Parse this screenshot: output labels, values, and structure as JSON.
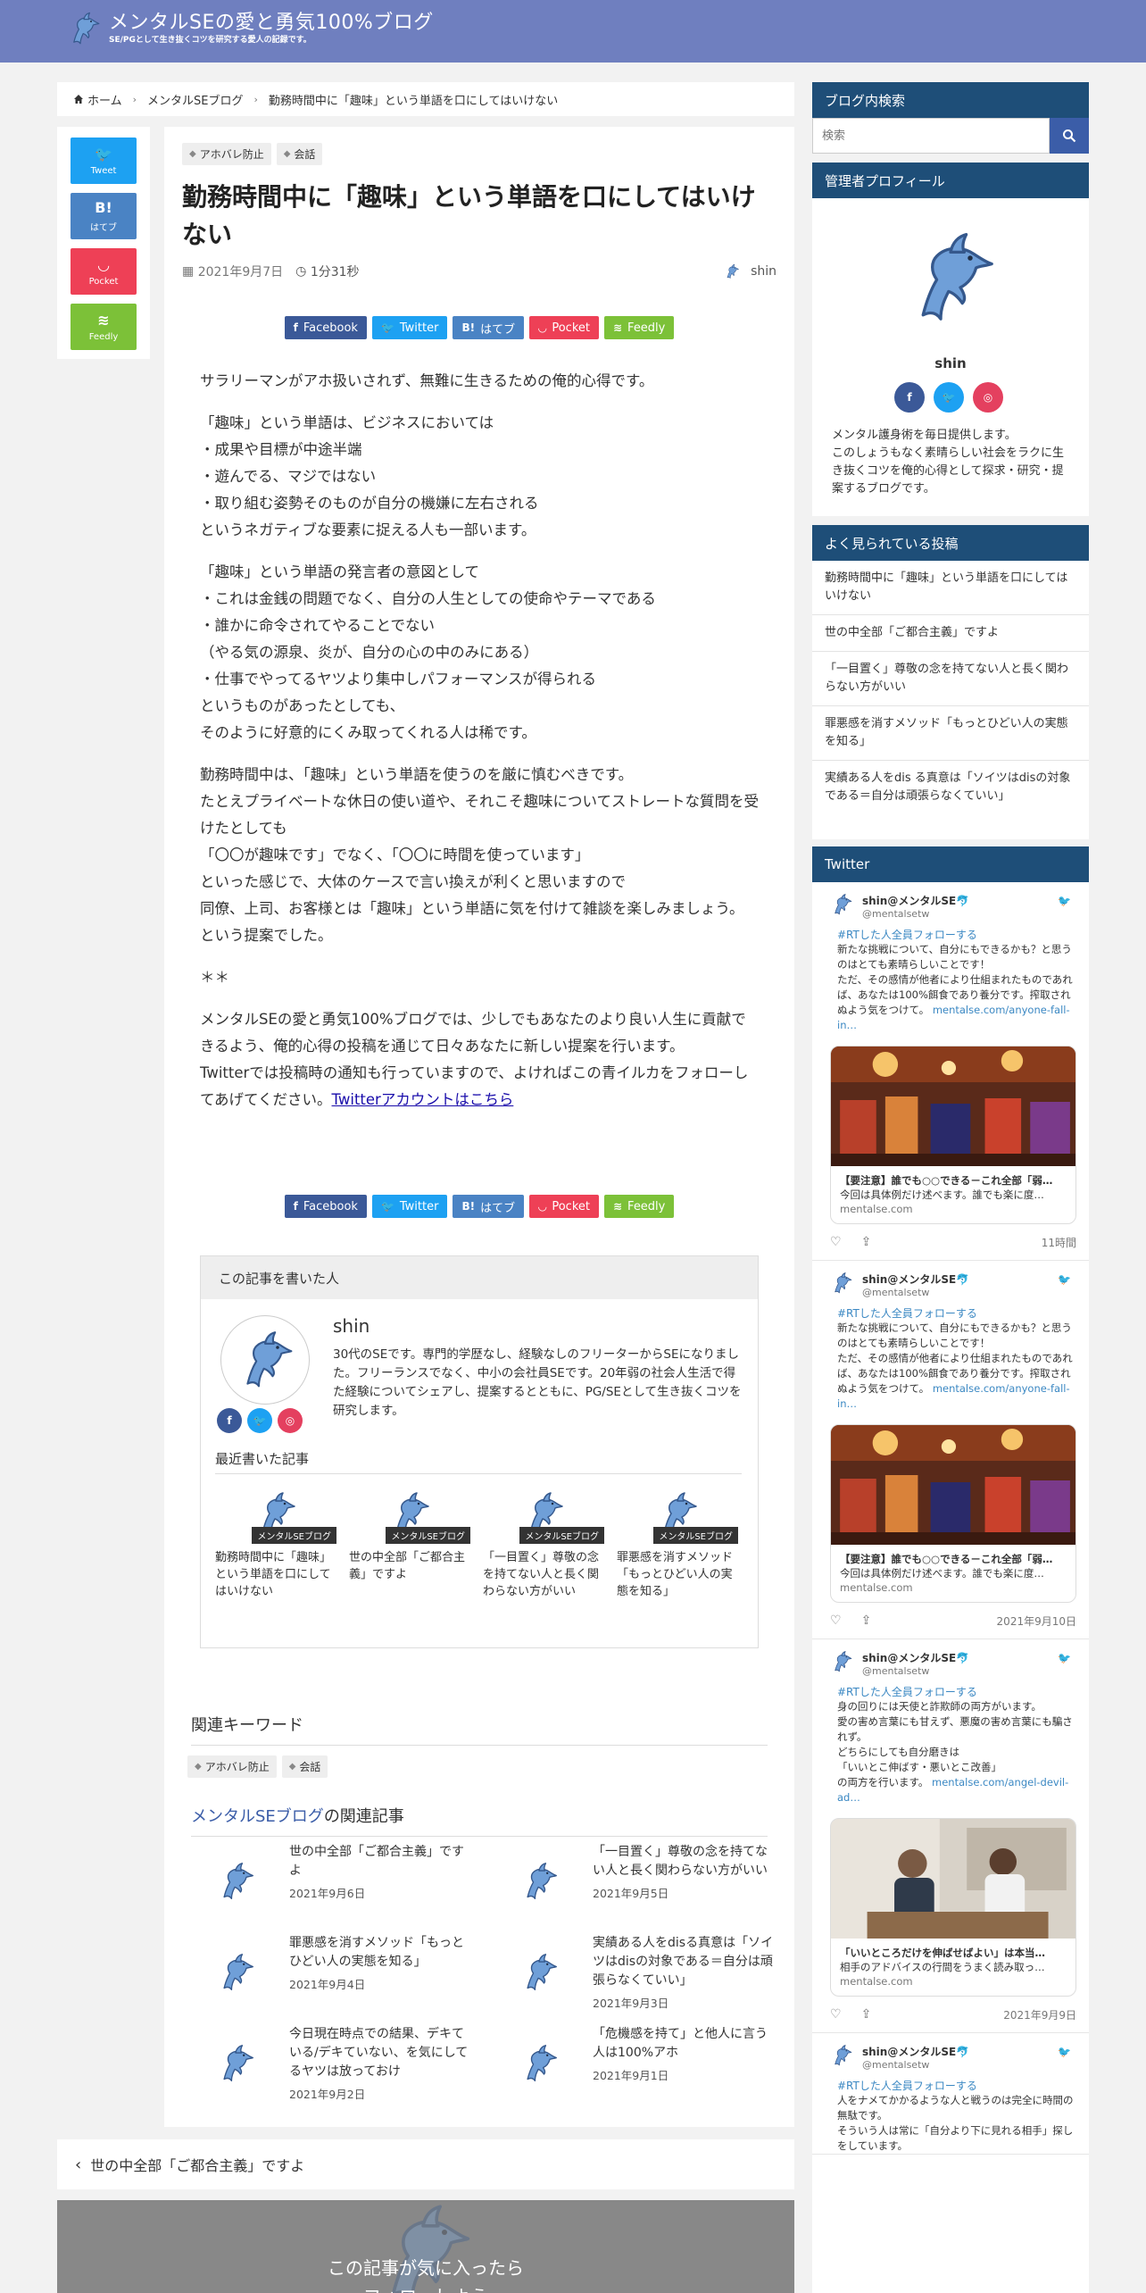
{
  "header": {
    "title": "メンタルSEの愛と勇気100%ブログ",
    "subtitle": "SE/PGとして生き抜くコツを研究する愛人の記録です。"
  },
  "breadcrumb": [
    "ホーム",
    "メンタルSEブログ",
    "勤務時間中に「趣味」という単語を口にしてはいけない"
  ],
  "side_share": [
    {
      "label": "Tweet",
      "icon": "twitter-bird-icon",
      "glyph": "🐦",
      "color": "#1da1f2"
    },
    {
      "label": "はてブ",
      "icon": "hatena-icon",
      "glyph": "B!",
      "color": "#4a83c4"
    },
    {
      "label": "Pocket",
      "icon": "pocket-icon",
      "glyph": "◡",
      "color": "#ee4056"
    },
    {
      "label": "Feedly",
      "icon": "feedly-icon",
      "glyph": "≋",
      "color": "#7cc138"
    }
  ],
  "article": {
    "tags": [
      "アホバレ防止",
      "会話"
    ],
    "title": "勤務時間中に「趣味」という単語を口にしてはいけない",
    "date": "2021年9月7日",
    "read_time": "1分31秒",
    "author": "shin",
    "paragraphs": [
      "サラリーマンがアホ扱いされず、無難に生きるための俺的心得です。",
      "「趣味」という単語は、ビジネスにおいては\n・成果や目標が中途半端\n・遊んでる、マジではない\n・取り組む姿勢そのものが自分の機嫌に左右される\nというネガティブな要素に捉える人も一部います。",
      "「趣味」という単語の発言者の意図として\n・これは金銭の問題でなく、自分の人生としての使命やテーマである\n・誰かに命令されてやることでない\n（やる気の源泉、炎が、自分の心の中のみにある）\n・仕事でやってるヤツより集中しパフォーマンスが得られる\nというものがあったとしても、\nそのように好意的にくみ取ってくれる人は稀です。",
      "勤務時間中は、「趣味」という単語を使うのを厳に慎むべきです。\nたとえプライベートな休日の使い道や、それこそ趣味についてストレートな質問を受けたとしても\n「〇〇が趣味です」でなく、「〇〇に時間を使っています」\nといった感じで、大体のケースで言い換えが利くと思いますので\n同僚、上司、お客様とは「趣味」という単語に気を付けて雑談を楽しみましょう。\nという提案でした。",
      "＊＊"
    ],
    "closing": "メンタルSEの愛と勇気100%ブログでは、少しでもあなたのより良い人生に貢献できるよう、俺的心得の投稿を通じて日々あなたに新しい提案を行います。\nTwitterでは投稿時の通知も行っていますので、よければこの青イルカをフォローしてあげてください。",
    "twitter_link": "Twitterアカウントはこちら",
    "share_buttons": [
      {
        "label": "Facebook",
        "glyph": "f",
        "color": "#3b5998"
      },
      {
        "label": "Twitter",
        "glyph": "🐦",
        "color": "#1da1f2"
      },
      {
        "label": "はてブ",
        "glyph": "B!",
        "color": "#4a83c4"
      },
      {
        "label": "Pocket",
        "glyph": "◡",
        "color": "#ee4056"
      },
      {
        "label": "Feedly",
        "glyph": "≋",
        "color": "#7cc138"
      }
    ]
  },
  "author_box": {
    "heading": "この記事を書いた人",
    "name": "shin",
    "description": "30代のSEです。専門的学歴なし、経験なしのフリーターからSEになりました。フリーランスでなく、中小の会社員SEです。20年弱の社会人生活で得た経験についてシェアし、提案するとともに、PG/SEとして生き抜くコツを研究します。",
    "recent_heading": "最近書いた記事",
    "recent_category": "メンタルSEブログ",
    "recent": [
      "勤務時間中に「趣味」という単語を口にしてはいけない",
      "世の中全部「ご都合主義」ですよ",
      "「一目置く」尊敬の念を持てない人と長く関わらない方がいい",
      "罪悪感を消すメソッド「もっとひどい人の実態を知る」"
    ]
  },
  "keywords": {
    "heading": "関連キーワード",
    "tags": [
      "アホバレ防止",
      "会話"
    ]
  },
  "related": {
    "heading_accent": "メンタルSEブログ",
    "heading_rest": "の関連記事",
    "items": [
      {
        "title": "世の中全部「ご都合主義」ですよ",
        "date": "2021年9月6日"
      },
      {
        "title": "「一目置く」尊敬の念を持てない人と長く関わらない方がいい",
        "date": "2021年9月5日"
      },
      {
        "title": "罪悪感を消すメソッド「もっとひどい人の実態を知る」",
        "date": "2021年9月4日"
      },
      {
        "title": "実績ある人をdisる真意は「ソイツはdisの対象である＝自分は頑張らなくていい」",
        "date": "2021年9月3日"
      },
      {
        "title": "今日現在時点での結果、デキている/デキていない、を気にしてるヤツは放っておけ",
        "date": "2021年9月2日"
      },
      {
        "title": "「危機感を持て」と他人に言う人は100%アホ",
        "date": "2021年9月1日"
      }
    ]
  },
  "prev_post": "世の中全部「ご都合主義」ですよ",
  "follow_box": "この記事が気に入ったら\nフォローしよう",
  "sidebar": {
    "search_heading": "ブログ内検索",
    "search_placeholder": "検索",
    "profile_heading": "管理者プロフィール",
    "profile_name": "shin",
    "profile_desc": "メンタル護身術を毎日提供します。\nこのしょうもなく素晴らしい社会をラクに生き抜くコツを俺的心得として探求・研究・提案するブログです。",
    "popular_heading": "よく見られている投稿",
    "popular": [
      "勤務時間中に「趣味」という単語を口にしてはいけない",
      "世の中全部「ご都合主義」ですよ",
      "「一目置く」尊敬の念を持てない人と長く関わらない方がいい",
      "罪悪感を消すメソッド「もっとひどい人の実態を知る」",
      "実績ある人をdis る真意は「ソイツはdisの対象である＝自分は頑張らなくていい」"
    ],
    "twitter_heading": "Twitter",
    "tweets": [
      {
        "name": "shin@メンタルSE🐬",
        "handle": "@mentalsetw",
        "rt": "#RTした人全員フォローする",
        "body": "新たな挑戦について、自分にもできるかも？と思うのはとても素晴らしいことです！\nただ、その感情が他者により仕組まれたものであれば、あなたは100%餌食であり養分です。搾取されぬよう気をつけて。",
        "link": "mentalse.com/anyone-fall-in…",
        "card_title": "【要注意】誰でも○○できる－これ全部「弱…",
        "card_desc": "今回は具体例だけ述べます。誰でも楽に度…",
        "card_domain": "mentalse.com",
        "card_theme": "casino",
        "time": "11時間"
      },
      {
        "name": "shin@メンタルSE🐬",
        "handle": "@mentalsetw",
        "rt": "#RTした人全員フォローする",
        "body": "新たな挑戦について、自分にもできるかも？と思うのはとても素晴らしいことです！\nただ、その感情が他者により仕組まれたものであれば、あなたは100%餌食であり養分です。搾取されぬよう気をつけて。",
        "link": "mentalse.com/anyone-fall-in…",
        "card_title": "【要注意】誰でも○○できる－これ全部「弱…",
        "card_desc": "今回は具体例だけ述べます。誰でも楽に度…",
        "card_domain": "mentalse.com",
        "card_theme": "casino",
        "time": "2021年9月10日"
      },
      {
        "name": "shin@メンタルSE🐬",
        "handle": "@mentalsetw",
        "rt": "#RTした人全員フォローする",
        "body": "身の回りには天使と詐欺師の両方がいます。\n愛の害め言葉にも甘えず、悪魔の害め言葉にも騙されず。\nどちらにしても自分磨きは\n「いいとこ伸ばす・悪いとこ改善」\nの両方を行います。",
        "link": "mentalse.com/angel-devil-ad…",
        "card_title": "「いいところだけを伸ばせばよい」は本当…",
        "card_desc": "相手のアドバイスの行間をうまく読み取っ…",
        "card_domain": "mentalse.com",
        "card_theme": "meeting",
        "time": "2021年9月9日"
      },
      {
        "name": "shin@メンタルSE🐬",
        "handle": "@mentalsetw",
        "rt": "#RTした人全員フォローする",
        "body": "人をナメてかかるような人と戦うのは完全に時間の無駄です。\nそういう人は常に「自分より下に見れる相手」探しをしています。",
        "link": "",
        "card_title": "",
        "card_desc": "",
        "card_domain": "",
        "card_theme": "",
        "time": ""
      }
    ]
  },
  "colors": {
    "header": "#6f7fbf",
    "widget_head": "#1e4e78",
    "accent_blue": "#3b5da8",
    "dolphin": "#6f9fd8"
  }
}
